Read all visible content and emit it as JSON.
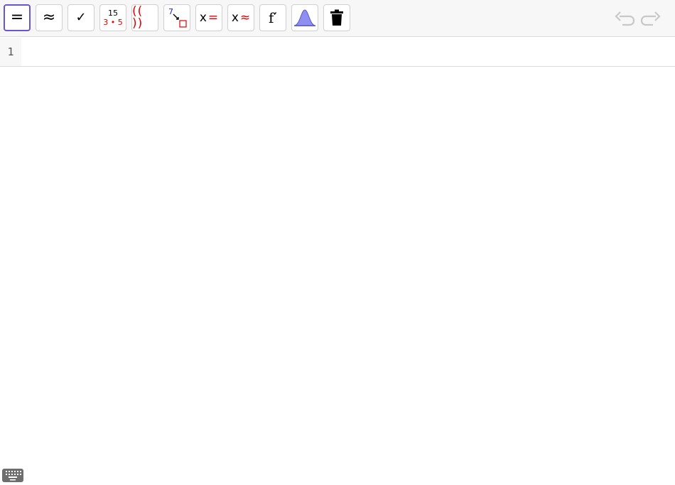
{
  "toolbar": {
    "tools": [
      {
        "name": "evaluate",
        "label": "="
      },
      {
        "name": "numeric",
        "label": "≈"
      },
      {
        "name": "keep-input",
        "label": "✓"
      },
      {
        "name": "factor",
        "top": "15",
        "bottom": "3 • 5"
      },
      {
        "name": "expand",
        "label": "(( ))"
      },
      {
        "name": "substitute",
        "label": "7"
      },
      {
        "name": "solve",
        "label_x": "x",
        "label_op": "="
      },
      {
        "name": "solve-numerically",
        "label_x": "x",
        "label_op": "≈"
      },
      {
        "name": "derivative",
        "label": "f′"
      },
      {
        "name": "probability-calculator",
        "icon": "bell-curve-icon"
      },
      {
        "name": "delete",
        "icon": "trash-icon"
      }
    ],
    "undo": {
      "icon": "undo-icon"
    },
    "redo": {
      "icon": "redo-icon"
    },
    "colors": {
      "selected_border": "#6557d2",
      "accent_red": "#e00000",
      "disabled_icon": "#c8c8c8"
    }
  },
  "cas_view": {
    "rows": [
      {
        "number": "1",
        "input": ""
      }
    ]
  },
  "keyboard_toggle": {
    "icon": "keyboard-icon"
  }
}
